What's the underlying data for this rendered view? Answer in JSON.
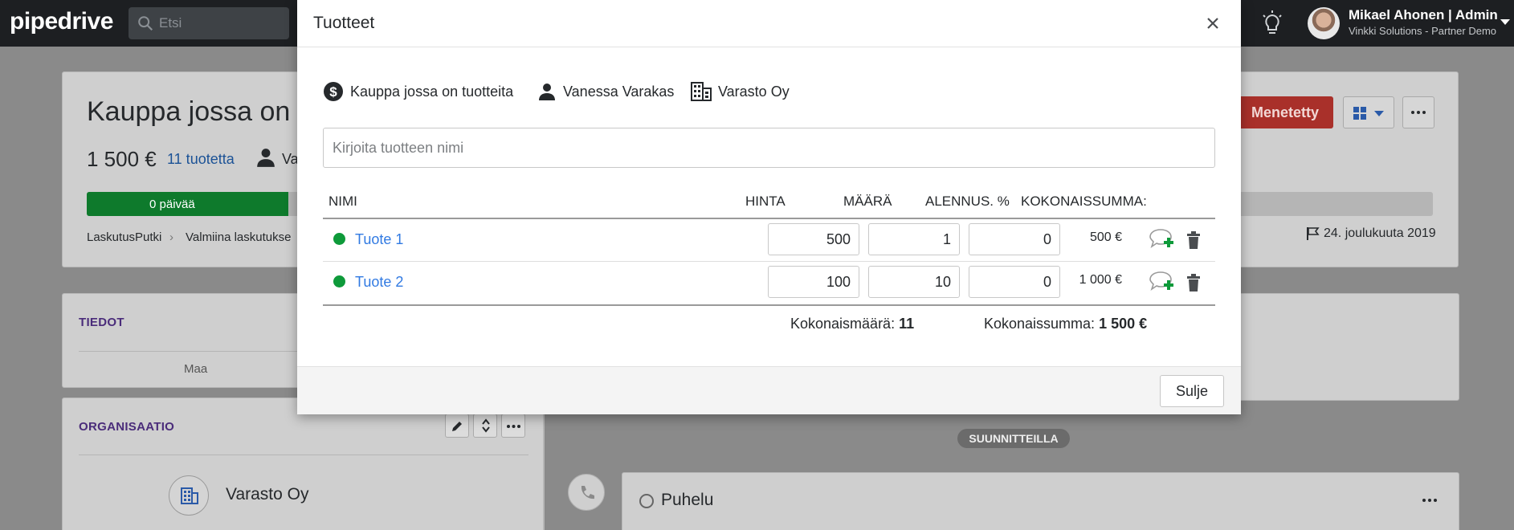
{
  "topbar": {
    "logo": "pipedrive",
    "search_placeholder": "Etsi",
    "user_name": "Mikael Ahonen | Admin",
    "user_company": "Vinkki Solutions - Partner Demo"
  },
  "deal": {
    "title": "Kauppa jossa on tu",
    "value": "1 500 €",
    "products_link": "11 tuotetta",
    "person_short": "Va",
    "stage_label": "0 päivää",
    "stage_progress": 0.15,
    "pipeline": "LaskutusPutki",
    "stage": "Valmiina laskutukse",
    "expected_close": "24. joulukuuta 2019",
    "lost_button": "Menetetty"
  },
  "sections": {
    "details_header": "TIEDOT",
    "country_label": "Maa",
    "org_header": "ORGANISAATIO",
    "org_name": "Varasto Oy"
  },
  "activity": {
    "status_pill": "SUUNNITTEILLA",
    "call_title": "Puhelu"
  },
  "modal": {
    "title": "Tuotteet",
    "deal_name": "Kauppa jossa on tuotteita",
    "person_name": "Vanessa Varakas",
    "org_name": "Varasto Oy",
    "product_input_placeholder": "Kirjoita tuotteen nimi",
    "columns": {
      "name": "NIMI",
      "price": "HINTA",
      "quantity": "MÄÄRÄ",
      "discount": "ALENNUS. %",
      "total": "KOKONAISSUMMA:"
    },
    "rows": [
      {
        "name": "Tuote 1",
        "price": "500",
        "quantity": "1",
        "discount": "0",
        "total": "500 €"
      },
      {
        "name": "Tuote 2",
        "price": "100",
        "quantity": "10",
        "discount": "0",
        "total": "1 000 €"
      }
    ],
    "summary": {
      "quantity_label": "Kokonaismäärä:",
      "quantity_value": "11",
      "sum_label": "Kokonaissumma:",
      "sum_value": "1 500 €"
    },
    "close_button": "Sulje"
  },
  "colors": {
    "accent_link": "#317ae2",
    "status_green": "#0e9a3a",
    "lost_red": "#a9302a"
  }
}
